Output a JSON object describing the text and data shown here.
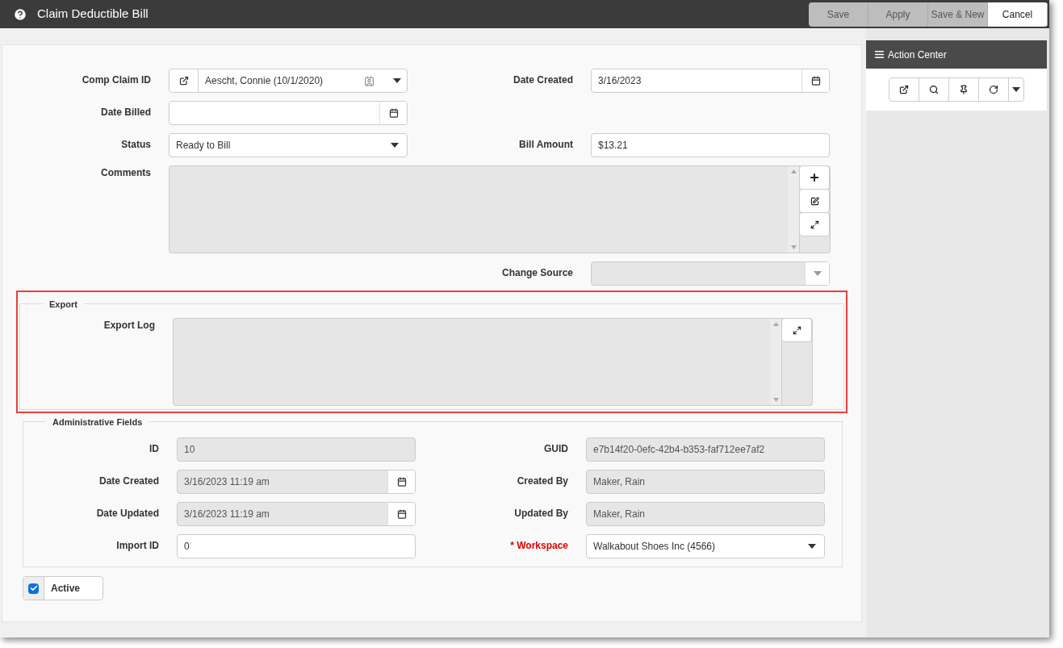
{
  "window": {
    "title": "Claim Deductible Bill"
  },
  "toolbar": [
    {
      "label": "Save",
      "disabled": true
    },
    {
      "label": "Apply",
      "disabled": true
    },
    {
      "label": "Save & New",
      "disabled": true
    },
    {
      "label": "Cancel",
      "disabled": false
    }
  ],
  "main": {
    "rows": [
      {
        "left": {
          "label": "Comp Claim ID",
          "kind": "lookup",
          "value": "Aescht, Connie (10/1/2020)",
          "disabled": false
        },
        "right": {
          "label": "Date Created",
          "kind": "date",
          "value": "3/16/2023",
          "disabled": false
        }
      },
      {
        "left": {
          "label": "Date Billed",
          "kind": "date",
          "disabled": false
        }
      },
      {
        "left": {
          "label": "Status",
          "kind": "select",
          "value": "Ready to Bill",
          "disabled": false
        },
        "right": {
          "label": "Bill Amount",
          "kind": "text",
          "value": "$13.21",
          "disabled": false
        }
      },
      {
        "wide": {
          "label": "Comments",
          "kind": "notes",
          "disabled": true
        }
      },
      {
        "right": {
          "label": "Change Source",
          "kind": "select",
          "disabled": true
        }
      }
    ]
  },
  "export": {
    "legend": "Export",
    "highlighted": true,
    "field": {
      "label": "Export Log",
      "kind": "log",
      "disabled": true
    }
  },
  "admin": {
    "legend": "Administrative Fields",
    "rows": [
      {
        "left": {
          "label": "ID",
          "kind": "text",
          "value": "10",
          "disabled": true
        },
        "right": {
          "label": "GUID",
          "kind": "text",
          "value": "e7b14f20-0efc-42b4-b353-faf712ee7af2",
          "disabled": true
        }
      },
      {
        "left": {
          "label": "Date Created",
          "kind": "date",
          "value": "3/16/2023 11:19 am",
          "disabled": true
        },
        "right": {
          "label": "Created By",
          "kind": "text",
          "value": "Maker, Rain",
          "disabled": true
        }
      },
      {
        "left": {
          "label": "Date Updated",
          "kind": "date",
          "value": "3/16/2023 11:19 am",
          "disabled": true
        },
        "right": {
          "label": "Updated By",
          "kind": "text",
          "value": "Maker, Rain",
          "disabled": true
        }
      },
      {
        "left": {
          "label": "Import ID",
          "kind": "text",
          "value": "0",
          "disabled": false
        },
        "right": {
          "label": "* Workspace",
          "kind": "select",
          "value": "Walkabout Shoes Inc (4566)",
          "disabled": false,
          "required": true
        }
      }
    ]
  },
  "active": {
    "label": "Active",
    "checked": true
  },
  "action_center": {
    "title": "Action Center"
  }
}
